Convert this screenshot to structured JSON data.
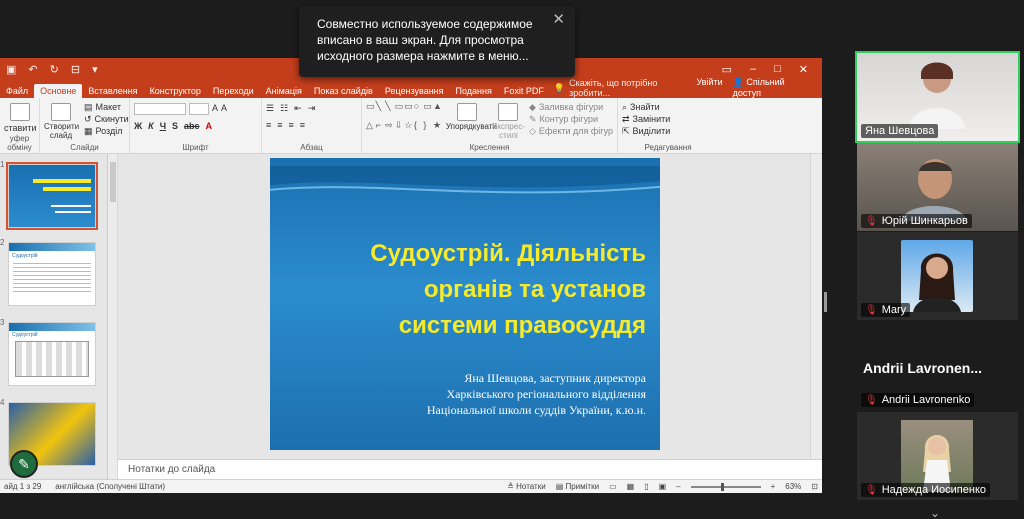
{
  "notification": {
    "text": "Совместно используемое содержимое вписано в ваш экран. Для просмотра исходного размера нажмите в меню..."
  },
  "ppt": {
    "menu_tabs": [
      "Файл",
      "Основне",
      "Вставлення",
      "Конструктор",
      "Переходи",
      "Анімація",
      "Показ слайдів",
      "Рецензування",
      "Подання",
      "Foxit PDF"
    ],
    "tell_me": "Скажіть, що потрібно зробити...",
    "signin": "Увійти",
    "share": "Спільний доступ",
    "groups": {
      "clipboard": "уфер обміну",
      "clipboard_btn": "ставити",
      "slides": "Слайди",
      "new_slide": "Створити слайд",
      "layout": "Макет",
      "reset": "Скинути",
      "section": "Розділ",
      "font": "Шрифт",
      "paragraph": "Абзац",
      "drawing": "Креслення",
      "arrange": "Упорядкувати",
      "quick_styles": "Експрес-стилі",
      "shape_fill": "Заливка фігури",
      "shape_outline": "Контур фігури",
      "shape_effects": "Ефекти для фігур",
      "editing": "Редагування",
      "find": "Знайти",
      "replace": "Замінити",
      "select": "Виділити"
    },
    "slide_numbers": [
      "1",
      "2",
      "3",
      "4"
    ],
    "thumb2_title": "Судоустрій",
    "thumb3_title": "Судоустрій",
    "slide": {
      "title": "Судоустрій. Діяльність органів та установ системи правосуддя",
      "author": "Яна Шевцова, заступник директора Харківського регіонального відділення Національної школи суддів України, к.ю.н."
    },
    "notes_placeholder": "Нотатки до слайда",
    "status": {
      "slide": "айд 1 з 29",
      "language": "англійська (Сполучені Штати)",
      "notes": "Нотатки",
      "comments": "Примітки",
      "zoom": "63%"
    }
  },
  "participants": [
    {
      "name": "Яна Шевцова"
    },
    {
      "name": "Юрій Шинкарьов"
    },
    {
      "name": "Mary"
    },
    {
      "name": "Andrii Lavronenko",
      "display": "Andrii Lavronen..."
    },
    {
      "name": "Надежда Иосипенко"
    }
  ]
}
